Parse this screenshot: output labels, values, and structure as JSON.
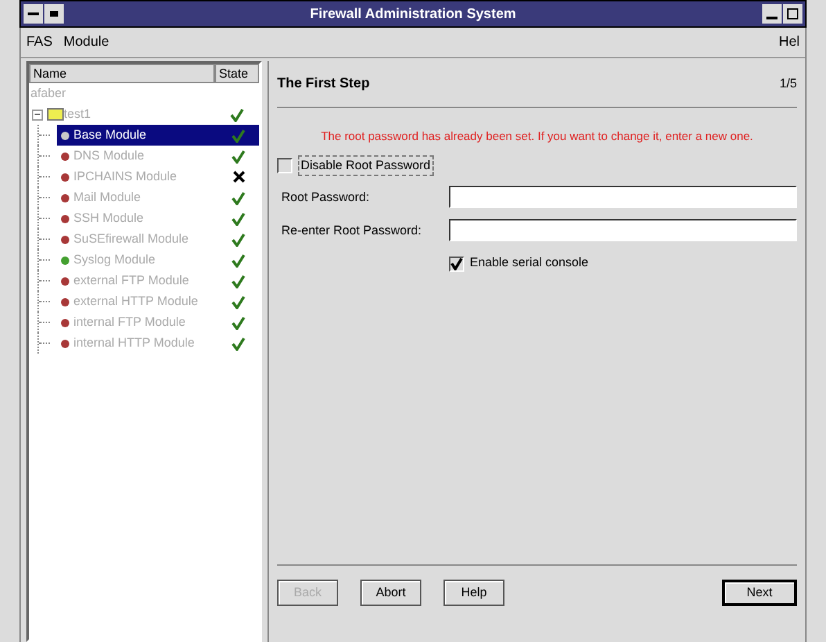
{
  "window": {
    "title": "Firewall Administration System"
  },
  "menu": [
    "FAS",
    "Module",
    "Hel"
  ],
  "tree": {
    "columns": [
      "Name",
      "State"
    ],
    "root": "afaber",
    "group": {
      "label": "test1",
      "passed": true,
      "expanded": true,
      "children": [
        {
          "label": "Base Module",
          "color": "#c8c8c8",
          "passed": true,
          "selected": true
        },
        {
          "label": "DNS Module",
          "color": "#a83838",
          "passed": true,
          "selected": false
        },
        {
          "label": "IPCHAINS Module",
          "color": "#a83838",
          "passed": false,
          "selected": false
        },
        {
          "label": "Mail Module",
          "color": "#a83838",
          "passed": true,
          "selected": false
        },
        {
          "label": "SSH Module",
          "color": "#a83838",
          "passed": true,
          "selected": false
        },
        {
          "label": "SuSEfirewall Module",
          "color": "#a83838",
          "passed": true,
          "selected": false
        },
        {
          "label": "Syslog Module",
          "color": "#44a030",
          "passed": true,
          "selected": false
        },
        {
          "label": "external FTP Module",
          "color": "#a83838",
          "passed": true,
          "selected": false
        },
        {
          "label": "external HTTP Module",
          "color": "#a83838",
          "passed": true,
          "selected": false
        },
        {
          "label": "internal FTP Module",
          "color": "#a83838",
          "passed": true,
          "selected": false
        },
        {
          "label": "internal HTTP Module",
          "color": "#a83838",
          "passed": true,
          "selected": false
        }
      ]
    }
  },
  "step": {
    "title": "The First Step",
    "counter": "1/5",
    "notice": "The root password has already been set. If you want to change it, enter a new one.",
    "disable_checkbox": {
      "label": "Disable Root Password",
      "checked": false
    },
    "fields": [
      {
        "label": "Root Password:"
      },
      {
        "label": "Re-enter Root Password:"
      }
    ],
    "serial_checkbox": {
      "label": "Enable serial console",
      "checked": true
    }
  },
  "buttons": [
    {
      "label": "Back",
      "disabled": true
    },
    {
      "label": "Abort",
      "disabled": false
    },
    {
      "label": "Help",
      "disabled": false
    },
    {
      "label": "Next",
      "disabled": false
    }
  ]
}
